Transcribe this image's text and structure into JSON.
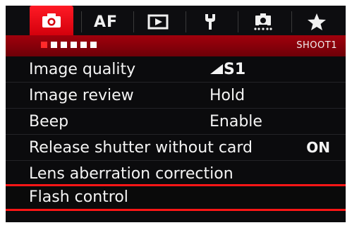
{
  "tabs": [
    {
      "label": "",
      "icon": "camera-icon",
      "active": true
    },
    {
      "label": "AF",
      "icon": "",
      "active": false
    },
    {
      "label": "",
      "icon": "playback-icon",
      "active": false
    },
    {
      "label": "",
      "icon": "wrench-icon",
      "active": false
    },
    {
      "label": "",
      "icon": "custom-function-camera-icon",
      "active": false
    },
    {
      "label": "",
      "icon": "star-icon",
      "active": false
    }
  ],
  "page_indicator": {
    "total": 6,
    "current": 1,
    "name": "SHOOT1"
  },
  "menu_items": [
    {
      "label": "Image quality",
      "value": "S1",
      "value_icon": "quality-wedge-icon"
    },
    {
      "label": "Image review",
      "value": "Hold"
    },
    {
      "label": "Beep",
      "value": "Enable"
    },
    {
      "label": "Release shutter without card",
      "value": "ON"
    },
    {
      "label": "Lens aberration correction",
      "value": ""
    },
    {
      "label": "Flash control",
      "value": "",
      "selected": true
    }
  ],
  "colors": {
    "accent": "#e3000f",
    "selection_border": "#ff1616",
    "background": "#0b0b0d",
    "text": "#f4f4f4"
  }
}
